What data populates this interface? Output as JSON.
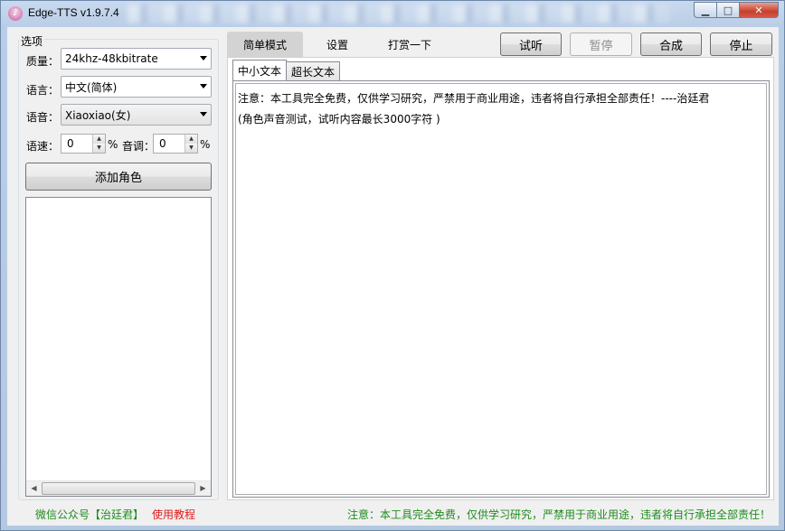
{
  "window": {
    "title": "Edge-TTS v1.9.7.4",
    "minimize_glyph": "▁",
    "maximize_glyph": "□",
    "close_glyph": "✕"
  },
  "options": {
    "group_label": "选项",
    "quality_label": "质量：",
    "quality_value": "24khz-48kbitrate",
    "language_label": "语言：",
    "language_value": "中文(简体)",
    "voice_label": "语音：",
    "voice_value": "Xiaoxiao(女)",
    "rate_label": "语速：",
    "rate_value": "0",
    "rate_unit": "%",
    "pitch_label": "音调：",
    "pitch_value": "0",
    "pitch_unit": "%",
    "add_role_label": "添加角色"
  },
  "top_tabs": [
    {
      "label": "简单模式",
      "active": true
    },
    {
      "label": "设置",
      "active": false
    },
    {
      "label": "打赏一下",
      "active": false
    }
  ],
  "actions": {
    "preview_label": "试听",
    "pause_label": "暂停",
    "synthesize_label": "合成",
    "stop_label": "停止"
  },
  "inner_tabs": [
    {
      "label": "中小文本",
      "active": true
    },
    {
      "label": "超长文本",
      "active": false
    }
  ],
  "editor": {
    "lines": [
      "注意：本工具完全免费，仅供学习研究，严禁用于商业用途，违者将自行承担全部责任！----治廷君",
      "(角色声音测试，试听内容最长3000字符 )"
    ]
  },
  "status": {
    "left_text": "微信公众号【治廷君】",
    "tutorial_link": "使用教程",
    "right_text": "注意：本工具完全免费，仅供学习研究，严禁用于商业用途，违者将自行承担全部责任！"
  },
  "colors": {
    "status_green": "#1e8c1e",
    "link_red": "#e01b1b"
  }
}
